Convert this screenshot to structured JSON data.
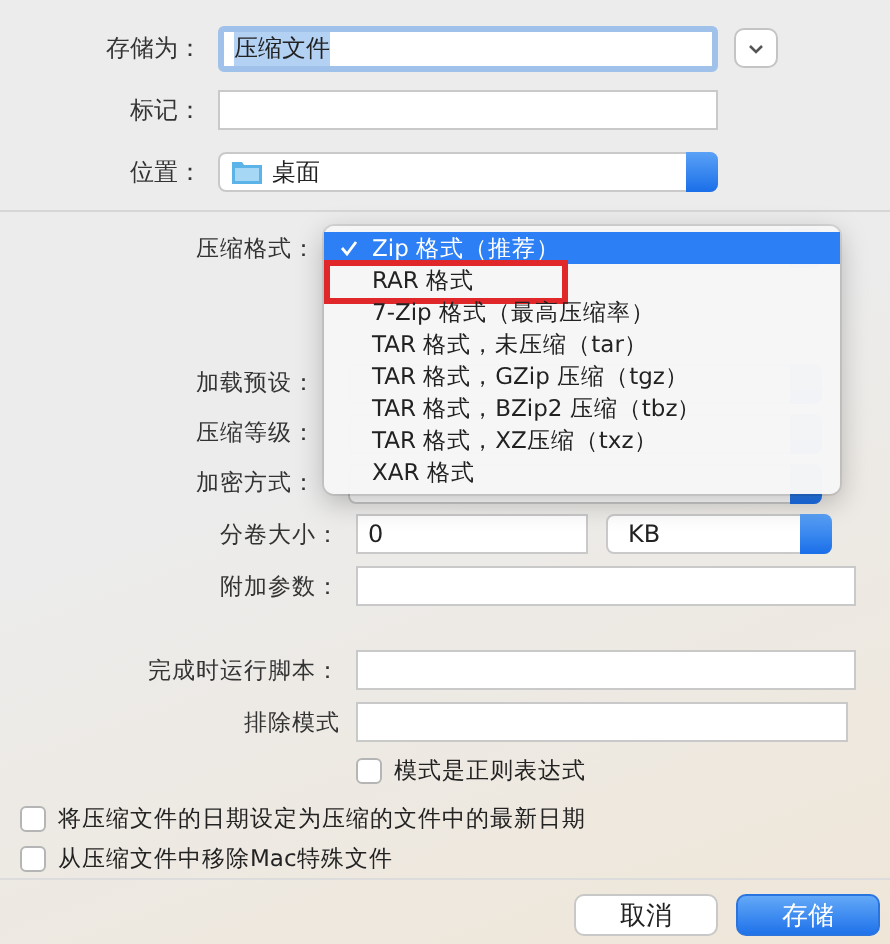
{
  "save_as": {
    "label": "存储为：",
    "value": "压缩文件",
    "text_selected": true
  },
  "tags": {
    "label": "标记："
  },
  "location": {
    "label": "位置：",
    "value": "桌面"
  },
  "format": {
    "label": "压缩格式：",
    "menu": [
      {
        "label": "Zip 格式（推荐）",
        "selected": true,
        "marked": false
      },
      {
        "label": "RAR 格式",
        "selected": false,
        "marked": true
      },
      {
        "label": "7-Zip 格式（最高压缩率）",
        "selected": false,
        "marked": false
      },
      {
        "label": "TAR 格式，未压缩（tar）",
        "selected": false,
        "marked": false
      },
      {
        "label": "TAR 格式，GZip 压缩（tgz）",
        "selected": false,
        "marked": false
      },
      {
        "label": "TAR 格式，BZip2 压缩（tbz）",
        "selected": false,
        "marked": false
      },
      {
        "label": "TAR 格式，XZ压缩（txz）",
        "selected": false,
        "marked": false
      },
      {
        "label": "XAR 格式",
        "selected": false,
        "marked": false
      }
    ]
  },
  "covered_rows": [
    {
      "label": "加载预设："
    },
    {
      "label": "压缩等级："
    },
    {
      "label": "加密方式："
    }
  ],
  "volume_size": {
    "label": "分卷大小：",
    "value": "0",
    "unit": "KB"
  },
  "extra_params": {
    "label": "附加参数："
  },
  "run_script": {
    "label": "完成时运行脚本："
  },
  "exclude": {
    "label": "排除模式",
    "regex": {
      "label": "模式是正则表达式",
      "checked": false
    }
  },
  "options": [
    {
      "label": "将压缩文件的日期设定为压缩的文件中的最新日期",
      "checked": false
    },
    {
      "label": "从压缩文件中移除Mac特殊文件",
      "checked": false
    }
  ],
  "buttons": [
    {
      "label": "取消",
      "kind": "secondary"
    },
    {
      "label": "存储",
      "kind": "primary"
    }
  ]
}
